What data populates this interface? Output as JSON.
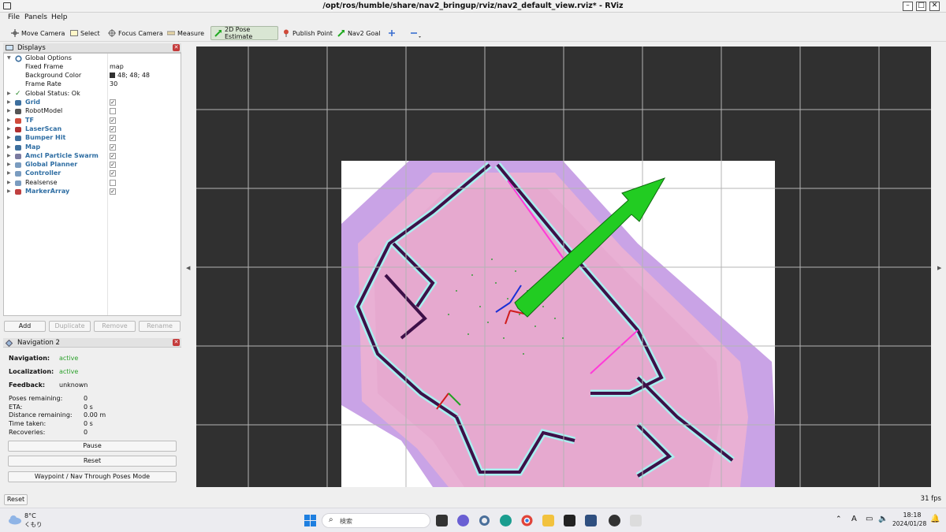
{
  "window": {
    "title": "/opt/ros/humble/share/nav2_bringup/rviz/nav2_default_view.rviz* - RViz"
  },
  "menu": [
    "File",
    "Panels",
    "Help"
  ],
  "toolbar": {
    "tools": [
      "Move Camera",
      "Select",
      "Focus Camera",
      "Measure",
      "2D Pose Estimate",
      "Publish Point",
      "Nav2 Goal"
    ],
    "active": "2D Pose Estimate"
  },
  "displays": {
    "title": "Displays",
    "global_options": "Global Options",
    "fixed_frame_label": "Fixed Frame",
    "fixed_frame": "map",
    "bg_color_label": "Background Color",
    "bg_color": "48; 48; 48",
    "frame_rate_label": "Frame Rate",
    "frame_rate": "30",
    "global_status": "Global Status: Ok",
    "items": [
      {
        "label": "Grid",
        "bold": true,
        "checked": true
      },
      {
        "label": "RobotModel",
        "bold": false,
        "checked": false
      },
      {
        "label": "TF",
        "bold": true,
        "checked": true
      },
      {
        "label": "LaserScan",
        "bold": true,
        "checked": true
      },
      {
        "label": "Bumper Hit",
        "bold": true,
        "checked": true
      },
      {
        "label": "Map",
        "bold": true,
        "checked": true
      },
      {
        "label": "Amcl Particle Swarm",
        "bold": true,
        "checked": true
      },
      {
        "label": "Global Planner",
        "bold": true,
        "checked": true
      },
      {
        "label": "Controller",
        "bold": true,
        "checked": true
      },
      {
        "label": "Realsense",
        "bold": false,
        "checked": false
      },
      {
        "label": "MarkerArray",
        "bold": true,
        "checked": true
      }
    ],
    "buttons": {
      "add": "Add",
      "duplicate": "Duplicate",
      "remove": "Remove",
      "rename": "Rename"
    }
  },
  "navigation": {
    "title": "Navigation 2",
    "navigation_label": "Navigation:",
    "navigation_value": "active",
    "localization_label": "Localization:",
    "localization_value": "active",
    "feedback_label": "Feedback:",
    "feedback_value": "unknown",
    "poses_remaining_label": "Poses remaining:",
    "poses_remaining": "0",
    "eta_label": "ETA:",
    "eta": "0 s",
    "distance_label": "Distance remaining:",
    "distance": "0.00 m",
    "time_taken_label": "Time taken:",
    "time_taken": "0 s",
    "recoveries_label": "Recoveries:",
    "recoveries": "0",
    "pause": "Pause",
    "reset": "Reset",
    "waypoint": "Waypoint / Nav Through Poses Mode"
  },
  "status": {
    "reset": "Reset",
    "fps": "31 fps"
  },
  "taskbar": {
    "weather_temp": "8°C",
    "weather_desc": "くもり",
    "search_placeholder": "検索",
    "ime": "A",
    "time": "18:18",
    "date": "2024/01/28"
  },
  "colors": {
    "viewport_bg": "#303030",
    "arrow": "#22cc22",
    "map_free": "#ffffff",
    "cost_high": "#e08ce0",
    "inflation": "#a8f0f0",
    "obstacle": "#3d1048"
  }
}
